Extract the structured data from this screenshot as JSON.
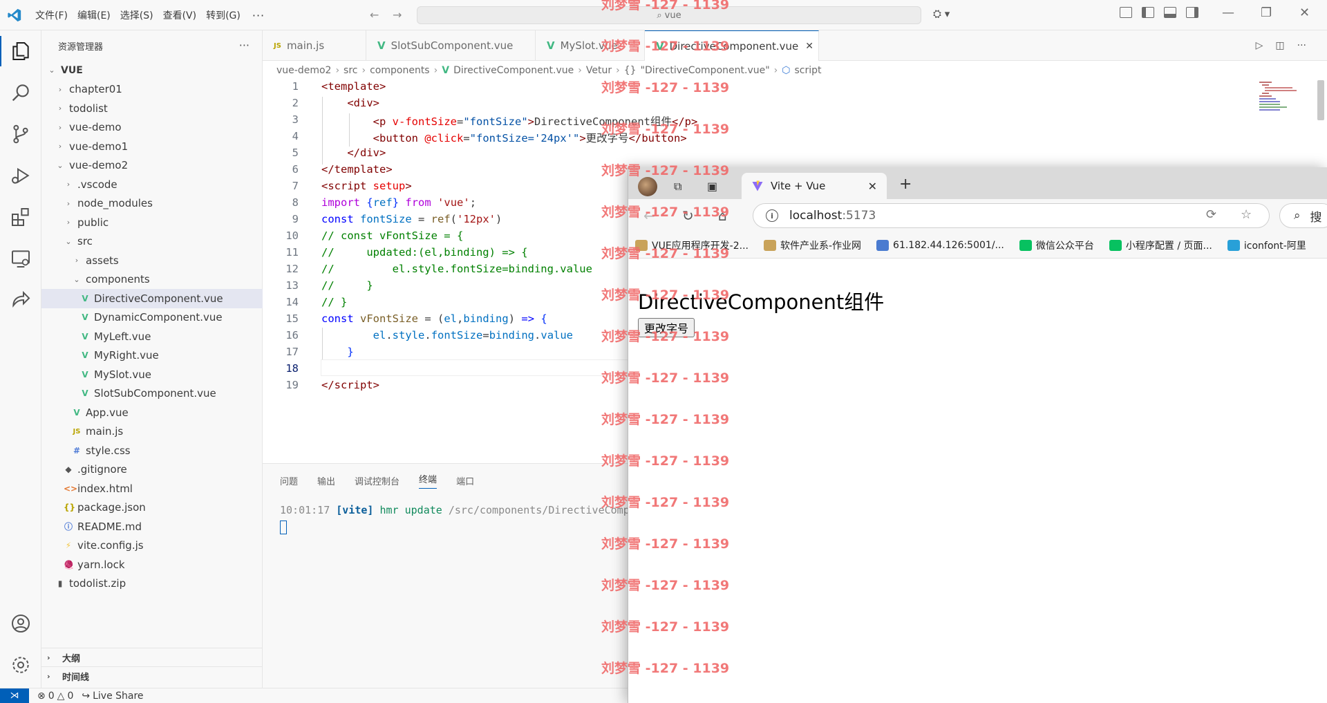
{
  "titlebar": {
    "menu": [
      "文件(F)",
      "编辑(E)",
      "选择(S)",
      "查看(V)",
      "转到(G)"
    ],
    "more": "···",
    "search_text": "vue"
  },
  "sidebar": {
    "title": "资源管理器",
    "more": "···",
    "root": "VUE",
    "items": [
      {
        "label": "chapter01",
        "indent": 1,
        "type": "folder",
        "open": false
      },
      {
        "label": "todolist",
        "indent": 1,
        "type": "folder",
        "open": false
      },
      {
        "label": "vue-demo",
        "indent": 1,
        "type": "folder",
        "open": false
      },
      {
        "label": "vue-demo1",
        "indent": 1,
        "type": "folder",
        "open": false
      },
      {
        "label": "vue-demo2",
        "indent": 1,
        "type": "folder",
        "open": true
      },
      {
        "label": ".vscode",
        "indent": 2,
        "type": "folder",
        "open": false
      },
      {
        "label": "node_modules",
        "indent": 2,
        "type": "folder",
        "open": false
      },
      {
        "label": "public",
        "indent": 2,
        "type": "folder",
        "open": false
      },
      {
        "label": "src",
        "indent": 2,
        "type": "folder",
        "open": true
      },
      {
        "label": "assets",
        "indent": 3,
        "type": "folder",
        "open": false
      },
      {
        "label": "components",
        "indent": 3,
        "type": "folder",
        "open": true
      },
      {
        "label": "DirectiveComponent.vue",
        "indent": 4,
        "type": "vue",
        "selected": true
      },
      {
        "label": "DynamicComponent.vue",
        "indent": 4,
        "type": "vue"
      },
      {
        "label": "MyLeft.vue",
        "indent": 4,
        "type": "vue"
      },
      {
        "label": "MyRight.vue",
        "indent": 4,
        "type": "vue"
      },
      {
        "label": "MySlot.vue",
        "indent": 4,
        "type": "vue"
      },
      {
        "label": "SlotSubComponent.vue",
        "indent": 4,
        "type": "vue"
      },
      {
        "label": "App.vue",
        "indent": 3,
        "type": "vue"
      },
      {
        "label": "main.js",
        "indent": 3,
        "type": "js"
      },
      {
        "label": "style.css",
        "indent": 3,
        "type": "css"
      },
      {
        "label": ".gitignore",
        "indent": 2,
        "type": "git"
      },
      {
        "label": "index.html",
        "indent": 2,
        "type": "html"
      },
      {
        "label": "package.json",
        "indent": 2,
        "type": "json"
      },
      {
        "label": "README.md",
        "indent": 2,
        "type": "info"
      },
      {
        "label": "vite.config.js",
        "indent": 2,
        "type": "vite"
      },
      {
        "label": "yarn.lock",
        "indent": 2,
        "type": "yarn"
      },
      {
        "label": "todolist.zip",
        "indent": 1,
        "type": "zip"
      }
    ],
    "outline": "大纲",
    "timeline": "时间线"
  },
  "tabs": [
    {
      "label": "main.js",
      "icon": "JS",
      "active": false
    },
    {
      "label": "SlotSubComponent.vue",
      "icon": "V",
      "active": false
    },
    {
      "label": "MySlot.vue",
      "icon": "V",
      "active": false
    },
    {
      "label": "DirectiveComponent.vue",
      "icon": "V",
      "active": true
    }
  ],
  "breadcrumb": [
    "vue-demo2",
    "src",
    "components",
    "DirectiveComponent.vue",
    "Vetur",
    "\"DirectiveComponent.vue\"",
    "script"
  ],
  "editor": {
    "current_line": 18,
    "line_numbers": [
      "1",
      "2",
      "3",
      "4",
      "5",
      "6",
      "7",
      "8",
      "9",
      "10",
      "11",
      "12",
      "13",
      "14",
      "15",
      "16",
      "17",
      "18",
      "19"
    ]
  },
  "panel": {
    "tabs": [
      "问题",
      "输出",
      "调试控制台",
      "终端",
      "端口"
    ],
    "active_tab": "终端",
    "terminal": {
      "time": "10:01:17",
      "tag": "[vite]",
      "msg": "hmr update",
      "path": "/src/components/DirectiveComp"
    }
  },
  "statusbar": {
    "errors": "0",
    "warnings": "0",
    "liveshare": "Live Share"
  },
  "browser": {
    "tab_title": "Vite + Vue",
    "url_host": "localhost",
    "url_port": ":5173",
    "search_placeholder": "搜",
    "bookmarks": [
      {
        "label": "VUE应用程序开发-2...",
        "color": "#c9a35a"
      },
      {
        "label": "软件产业系-作业网",
        "color": "#c9a35a"
      },
      {
        "label": "61.182.44.126:5001/...",
        "color": "#4a7bd0"
      },
      {
        "label": "微信公众平台",
        "color": "#07c160"
      },
      {
        "label": "小程序配置 / 页面...",
        "color": "#07c160"
      },
      {
        "label": "iconfont-阿里",
        "color": "#28a0d8"
      }
    ],
    "page": {
      "heading": "DirectiveComponent组件",
      "button": "更改字号"
    }
  },
  "watermark": "刘梦雪 -127 - 1139"
}
